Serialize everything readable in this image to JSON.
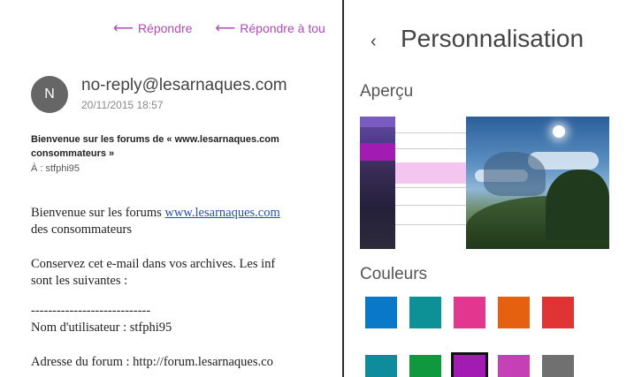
{
  "mail": {
    "actions": [
      {
        "icon": "reply-arrow-icon",
        "label": "Répondre"
      },
      {
        "icon": "reply-all-arrow-icon",
        "label": "Répondre à tou"
      }
    ],
    "avatar_letter": "N",
    "sender": "no-reply@lesarnaques.com",
    "date": "20/11/2015 18:57",
    "subject_line1": "Bienvenue sur les forums de « www.lesarnaques.com",
    "subject_line2": "consommateurs »",
    "to": "À : stfphi95",
    "body": {
      "p1_prefix": "Bienvenue sur les forums ",
      "p1_link": "www.lesarnaques.com",
      "p1_line2": "des consommateurs",
      "p2_line1": "Conservez cet e-mail dans vos archives. Les inf",
      "p2_line2": "sont les suivantes :",
      "separator": "----------------------------",
      "username_line": "Nom d'utilisateur : stfphi95",
      "forum_address_line": "Adresse du forum : http://forum.lesarnaques.co"
    }
  },
  "settings": {
    "back_icon": "chevron-left-icon",
    "back_glyph": "‹",
    "title": "Personnalisation",
    "apercu_label": "Aperçu",
    "couleurs_label": "Couleurs",
    "accent_selected": "#a21bb3",
    "colors_row1": [
      "#0a78c8",
      "#0d9196",
      "#e3378f",
      "#e5610f",
      "#e03434"
    ],
    "colors_row2": [
      "#0f8b9e",
      "#10983e",
      "#a21bb3",
      "#c640b5",
      "#707070"
    ],
    "selected_row2_index": 2
  }
}
